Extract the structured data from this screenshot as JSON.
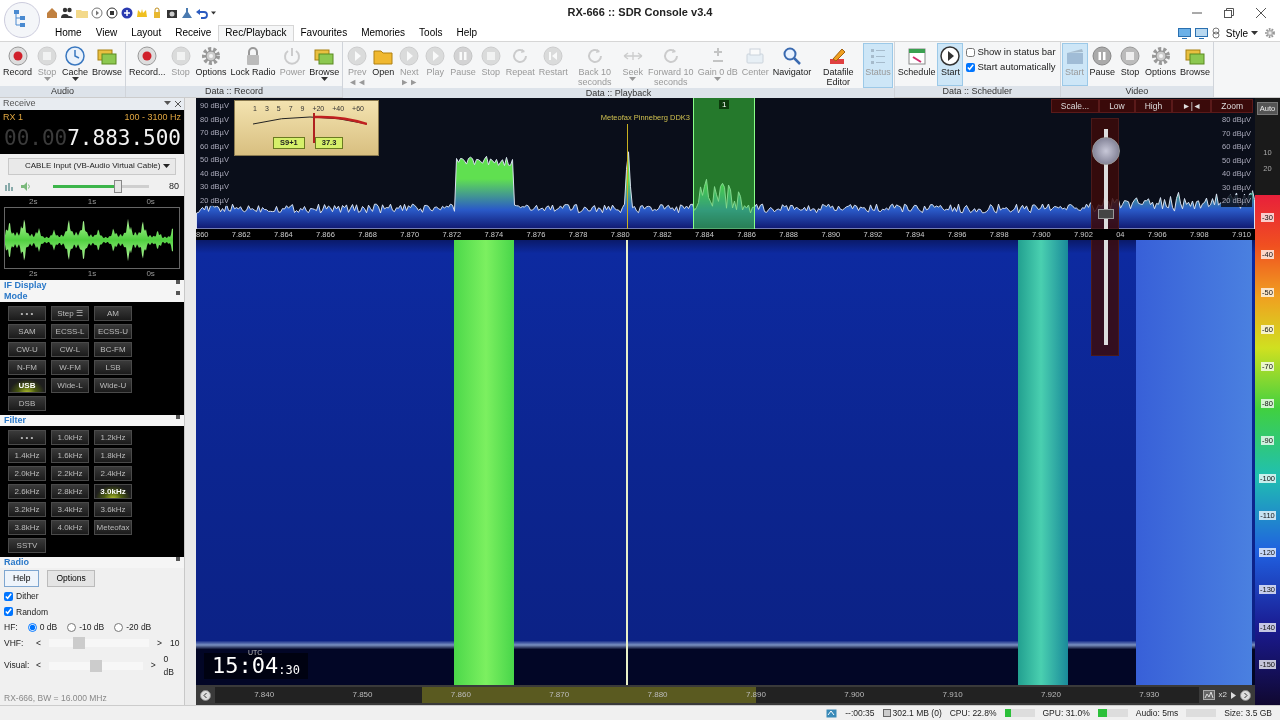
{
  "window": {
    "title": "RX-666 :: SDR Console v3.4"
  },
  "menu": [
    {
      "label": "Home",
      "selected": false
    },
    {
      "label": "View",
      "selected": false
    },
    {
      "label": "Layout",
      "selected": false
    },
    {
      "label": "Receive",
      "selected": false
    },
    {
      "label": "Rec/Playback",
      "selected": true
    },
    {
      "label": "Favourites",
      "selected": false
    },
    {
      "label": "Memories",
      "selected": false
    },
    {
      "label": "Tools",
      "selected": false
    },
    {
      "label": "Help",
      "selected": false
    }
  ],
  "style_menu": "Style",
  "ribbon_groups": [
    {
      "label": "Audio",
      "buttons": [
        {
          "label": "Record",
          "disabled": false,
          "pressed": false,
          "dropdown": false
        },
        {
          "label": "Stop",
          "disabled": true,
          "pressed": false,
          "dropdown": true
        },
        {
          "label": "Cache",
          "disabled": false,
          "pressed": false,
          "dropdown": true
        },
        {
          "label": "Browse",
          "disabled": false,
          "pressed": false,
          "dropdown": false
        }
      ]
    },
    {
      "label": "Data :: Record",
      "buttons": [
        {
          "label": "Record...",
          "disabled": false,
          "pressed": false,
          "dropdown": false
        },
        {
          "label": "Stop",
          "disabled": true,
          "pressed": false,
          "dropdown": false
        },
        {
          "label": "Options",
          "disabled": false,
          "pressed": false,
          "dropdown": false
        },
        {
          "label": "Lock Radio",
          "disabled": false,
          "pressed": false,
          "dropdown": false
        },
        {
          "label": "Power",
          "disabled": true,
          "pressed": false,
          "dropdown": false
        },
        {
          "label": "Browse",
          "disabled": false,
          "pressed": false,
          "dropdown": true
        }
      ]
    },
    {
      "label": "Data :: Playback",
      "buttons": [
        {
          "label": "Prev",
          "sub": "◄◄",
          "disabled": true,
          "pressed": false,
          "dropdown": false
        },
        {
          "label": "Open",
          "disabled": false,
          "pressed": false,
          "dropdown": false
        },
        {
          "label": "Next",
          "sub": "►►",
          "disabled": true,
          "pressed": false,
          "dropdown": false
        },
        {
          "label": "Play",
          "disabled": true,
          "pressed": false,
          "dropdown": false
        },
        {
          "label": "Pause",
          "disabled": true,
          "pressed": false,
          "dropdown": false
        },
        {
          "label": "Stop",
          "disabled": true,
          "pressed": false,
          "dropdown": false
        },
        {
          "label": "Repeat",
          "disabled": true,
          "pressed": false,
          "dropdown": false
        },
        {
          "label": "Restart",
          "disabled": true,
          "pressed": false,
          "dropdown": false
        },
        {
          "label": "Back 10 seconds",
          "disabled": true,
          "pressed": false,
          "dropdown": false
        },
        {
          "label": "Seek",
          "disabled": true,
          "pressed": false,
          "dropdown": true
        },
        {
          "label": "Forward 10 seconds",
          "disabled": true,
          "pressed": false,
          "dropdown": false
        },
        {
          "label": "Gain 0 dB",
          "disabled": true,
          "pressed": false,
          "dropdown": true
        },
        {
          "label": "Center",
          "disabled": true,
          "pressed": false,
          "dropdown": false
        },
        {
          "label": "Navigator",
          "disabled": false,
          "pressed": false,
          "dropdown": false
        },
        {
          "label": "Datafile Editor",
          "disabled": false,
          "pressed": false,
          "dropdown": false
        },
        {
          "label": "Status",
          "disabled": true,
          "pressed": true,
          "dropdown": false
        }
      ]
    },
    {
      "label": "Data :: Scheduler",
      "buttons": [
        {
          "label": "Schedule",
          "disabled": false,
          "pressed": false,
          "dropdown": false
        },
        {
          "label": "Start",
          "disabled": false,
          "pressed": true,
          "dropdown": false
        }
      ],
      "options": [
        {
          "label": "Show in status bar",
          "checked": false
        },
        {
          "label": "Start automatically",
          "checked": true
        }
      ]
    },
    {
      "label": "Video",
      "buttons": [
        {
          "label": "Start",
          "disabled": true,
          "pressed": true,
          "dropdown": false
        },
        {
          "label": "Pause",
          "disabled": false,
          "pressed": false,
          "dropdown": false
        },
        {
          "label": "Stop",
          "disabled": false,
          "pressed": false,
          "dropdown": false
        },
        {
          "label": "Options",
          "disabled": false,
          "pressed": false,
          "dropdown": false
        },
        {
          "label": "Browse",
          "disabled": false,
          "pressed": false,
          "dropdown": false
        }
      ]
    }
  ],
  "receive_panel": {
    "title": "Receive",
    "rx_label": "RX 1",
    "passband": "100 - 3100 Hz",
    "frequency_dim": "00.00",
    "frequency": "7.883.500",
    "audio_device": "CABLE Input (VB-Audio Virtual Cable)",
    "volume": {
      "level": 0.68,
      "reading": "80"
    },
    "scope_top_labels": [
      "2s",
      "1s",
      "0s"
    ],
    "scope_bottom_labels": [
      "2s",
      "1s",
      "0s"
    ]
  },
  "if_display": {
    "title": "IF Display"
  },
  "mode": {
    "title": "Mode",
    "buttons": [
      {
        "label": "• • •",
        "selected": false
      },
      {
        "label": "Step ☰",
        "selected": false
      },
      {
        "label": "AM",
        "selected": false
      },
      {
        "label": "SAM",
        "selected": false
      },
      {
        "label": "ECSS-L",
        "selected": false
      },
      {
        "label": "ECSS-U",
        "selected": false
      },
      {
        "label": "CW-U",
        "selected": false
      },
      {
        "label": "CW-L",
        "selected": false
      },
      {
        "label": "BC-FM",
        "selected": false
      },
      {
        "label": "N-FM",
        "selected": false
      },
      {
        "label": "W-FM",
        "selected": false
      },
      {
        "label": "LSB",
        "selected": false
      },
      {
        "label": "USB",
        "selected": true
      },
      {
        "label": "Wide-L",
        "selected": false
      },
      {
        "label": "Wide-U",
        "selected": false
      },
      {
        "label": "DSB",
        "selected": false
      }
    ]
  },
  "filter": {
    "title": "Filter",
    "buttons": [
      {
        "label": "• • •",
        "selected": false
      },
      {
        "label": "1.0kHz",
        "selected": false
      },
      {
        "label": "1.2kHz",
        "selected": false
      },
      {
        "label": "1.4kHz",
        "selected": false
      },
      {
        "label": "1.6kHz",
        "selected": false
      },
      {
        "label": "1.8kHz",
        "selected": false
      },
      {
        "label": "2.0kHz",
        "selected": false
      },
      {
        "label": "2.2kHz",
        "selected": false
      },
      {
        "label": "2.4kHz",
        "selected": false
      },
      {
        "label": "2.6kHz",
        "selected": false
      },
      {
        "label": "2.8kHz",
        "selected": false
      },
      {
        "label": "3.0kHz",
        "selected": true
      },
      {
        "label": "3.2kHz",
        "selected": false
      },
      {
        "label": "3.4kHz",
        "selected": false
      },
      {
        "label": "3.6kHz",
        "selected": false
      },
      {
        "label": "3.8kHz",
        "selected": false
      },
      {
        "label": "4.0kHz",
        "selected": false
      },
      {
        "label": "Meteofax",
        "selected": false
      },
      {
        "label": "SSTV",
        "selected": false
      }
    ]
  },
  "radio": {
    "title": "Radio",
    "buttons": [
      "Help",
      "Options"
    ],
    "checkboxes": [
      {
        "label": "Dither",
        "checked": true
      },
      {
        "label": "Random",
        "checked": true
      }
    ],
    "hf": {
      "label": "HF:",
      "options": [
        {
          "label": "0 dB",
          "selected": true
        },
        {
          "label": "-10 dB",
          "selected": false
        },
        {
          "label": "-20 dB",
          "selected": false
        }
      ]
    },
    "vhf": {
      "label": "VHF:",
      "left": "<",
      "right": ">",
      "level": 0.3,
      "reading": "10"
    },
    "visual": {
      "label": "Visual:",
      "left": "<",
      "right": ">",
      "level": 0.5,
      "reading": "0 dB"
    }
  },
  "panel_status": "RX-666, BW = 16.000 MHz",
  "spectrum": {
    "y_labels_left": [
      "90 dBµV",
      "80 dBµV",
      "70 dBµV",
      "60 dBµV",
      "50 dBµV",
      "40 dBµV",
      "30 dBµV",
      "20 dBµV"
    ],
    "y_labels_right": [
      "80 dBµV",
      "70 dBµV",
      "60 dBµV",
      "50 dBµV",
      "40 dBµV",
      "30 dBµV",
      "20 dBµV"
    ],
    "s_meter": {
      "scale": [
        "1",
        "3",
        "5",
        "7",
        "9",
        "+20",
        "+40",
        "+60"
      ],
      "s_reading": "S9+1",
      "db_reading": "37.3",
      "level": 0.55
    },
    "marker_label": "Meteofax Pinneberg DDK3",
    "filter_label": "1",
    "tools": [
      "Scale...",
      "Low",
      "High",
      "►|◄",
      "Zoom"
    ],
    "contrast": {
      "level": 0.9
    },
    "freq_labels": [
      "860",
      "7.862",
      "7.864",
      "7.866",
      "7.868",
      "7.870",
      "7.872",
      "7.874",
      "7.876",
      "7.878",
      "7.880",
      "7.882",
      "7.884",
      "7.886",
      "7.888",
      "7.890",
      "7.892",
      "7.894",
      "7.896",
      "7.898",
      "7.900",
      "7.902",
      "04",
      "7.906",
      "7.908",
      "7.910"
    ]
  },
  "waterfall": {
    "time": "15:04",
    "seconds": ":30",
    "timezone": "UTC"
  },
  "overview": {
    "freq_labels": [
      "7.840",
      "7.850",
      "7.860",
      "7.870",
      "7.880",
      "7.890",
      "7.900",
      "7.910",
      "7.920",
      "7.930"
    ],
    "zoom": "x2"
  },
  "color_scale": {
    "auto": "Auto",
    "top_labels": [
      "10",
      "20"
    ],
    "labels": [
      "-30",
      "-40",
      "-50",
      "-60",
      "-70",
      "-80",
      "-90",
      "-100",
      "-110",
      "-120",
      "-130",
      "-140",
      "-150"
    ]
  },
  "status_bar": {
    "recording_time": "--:00:35",
    "memory": "302.1 MB (0)",
    "cpu": {
      "label": "CPU: 22.8%",
      "level": 0.228
    },
    "gpu": {
      "label": "GPU: 31.0%",
      "level": 0.31
    },
    "audio": "Audio: 5ms",
    "size": "Size: 3.5 GB"
  }
}
